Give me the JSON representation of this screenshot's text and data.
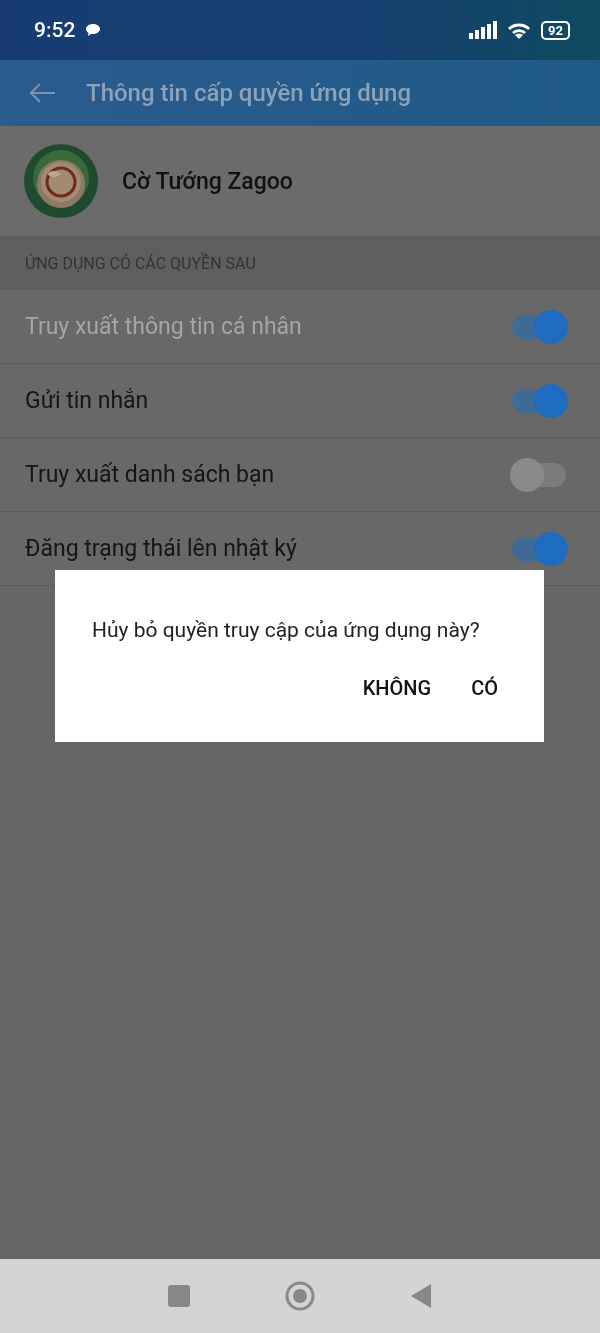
{
  "status_bar": {
    "time": "9:52",
    "battery": "92"
  },
  "app_bar": {
    "title": "Thông tin cấp quyền ứng dụng"
  },
  "app": {
    "name": "Cờ Tướng Zagoo"
  },
  "section": {
    "title": "ỨNG DỤNG CÓ CÁC QUYỀN SAU"
  },
  "permissions": [
    {
      "label": "Truy xuất thông tin cá nhân",
      "on": true,
      "disabled": true
    },
    {
      "label": "Gửi tin nhắn",
      "on": true,
      "disabled": false
    },
    {
      "label": "Truy xuất danh sách bạn",
      "on": false,
      "disabled": false
    },
    {
      "label": "Đăng trạng thái lên nhật ký",
      "on": true,
      "disabled": false
    }
  ],
  "dialog": {
    "message": "Hủy bỏ quyền truy cập của ứng dụng này?",
    "buttons": [
      "KHÔNG",
      "CÓ"
    ]
  }
}
